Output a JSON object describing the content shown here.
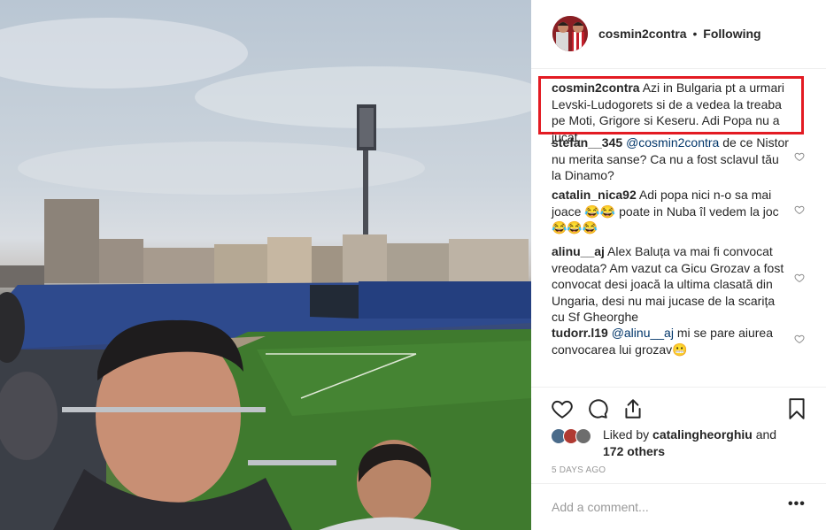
{
  "post": {
    "username": "cosmin2contra",
    "separator": "•",
    "follow_state": "Following",
    "caption": {
      "user": "cosmin2contra",
      "text": "Azi in Bulgaria pt a urmari Levski-Ludogorets si de a vedea la treaba pe Moti, Grigore si Keseru. Adi Popa nu a jucat."
    },
    "comments": [
      {
        "user": "stefan__345",
        "mention": "@cosmin2contra",
        "text": " de ce Nistor nu merita sanse? Ca nu a fost sclavul tău la Dinamo?"
      },
      {
        "user": "catalin_nica92",
        "mention": "",
        "text": "Adi popa nici n-o sa mai joace 😂😂 poate in Nuba îl vedem la joc 😂😂😂"
      },
      {
        "user": "alinu__aj",
        "mention": "",
        "text": "Alex Baluța va mai fi convocat vreodata? Am vazut ca Gicu Grozav a fost convocat desi joacă la ultima clasată din Ungaria, desi nu mai jucase de la scarița cu Sf Gheorghe"
      },
      {
        "user": "tudorr.l19",
        "mention": "@alinu__aj",
        "text": " mi se pare aiurea convocarea lui grozav😬"
      }
    ],
    "likes": {
      "prefix": "Liked by",
      "user": "catalingheorghiu",
      "suffix_and": "and",
      "others": "172 others"
    },
    "time_ago": "5 DAYS AGO",
    "add_comment_placeholder": "Add a comment...",
    "more_label": "•••"
  },
  "icons": {
    "like": "heart-icon",
    "comment": "comment-bubble-icon",
    "share": "share-icon",
    "save": "bookmark-icon"
  },
  "colors": {
    "highlight_box": "#e31b23",
    "mention": "#003569",
    "muted": "#999999"
  }
}
